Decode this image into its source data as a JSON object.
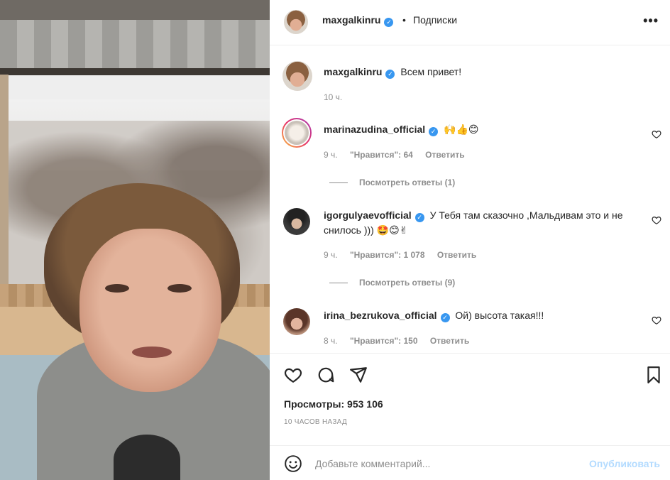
{
  "post": {
    "author": "maxgalkinru",
    "follow_label": "Подписки",
    "separator": "•",
    "more": "•••",
    "caption_author": "maxgalkinru",
    "caption": "Всем привет!",
    "caption_time": "10 ч."
  },
  "comments": [
    {
      "author": "marinazudina_official",
      "text": "🙌👍😊",
      "time": "9 ч.",
      "likes": "\"Нравится\": 64",
      "reply": "Ответить",
      "view_replies": "Посмотреть ответы (1)"
    },
    {
      "author": "igorgulyaevofficial",
      "text": "У Тебя там сказочно ,Мальдивам это и не снилось ))) 🤩😊✌",
      "time": "9 ч.",
      "likes": "\"Нравится\": 1 078",
      "reply": "Ответить",
      "view_replies": "Посмотреть ответы (9)"
    },
    {
      "author": "irina_bezrukova_official",
      "text": "Ой) высота такая!!!",
      "time": "8 ч.",
      "likes": "\"Нравится\": 150",
      "reply": "Ответить"
    }
  ],
  "stats": {
    "views": "Просмотры: 953 106",
    "posted_ago": "10 часов назад"
  },
  "composer": {
    "placeholder": "Добавьте комментарий...",
    "publish": "Опубликовать"
  },
  "icons": {
    "verified": "verified-badge-icon",
    "like": "heart-icon",
    "comment": "comment-bubble-icon",
    "share": "paper-plane-icon",
    "save": "bookmark-icon",
    "emoji": "smiley-icon",
    "more": "ellipsis-icon"
  },
  "colors": {
    "verified": "#3897f0",
    "muted_text": "#8e8e8e",
    "publish_disabled": "#b3dbff",
    "text": "#262626"
  }
}
